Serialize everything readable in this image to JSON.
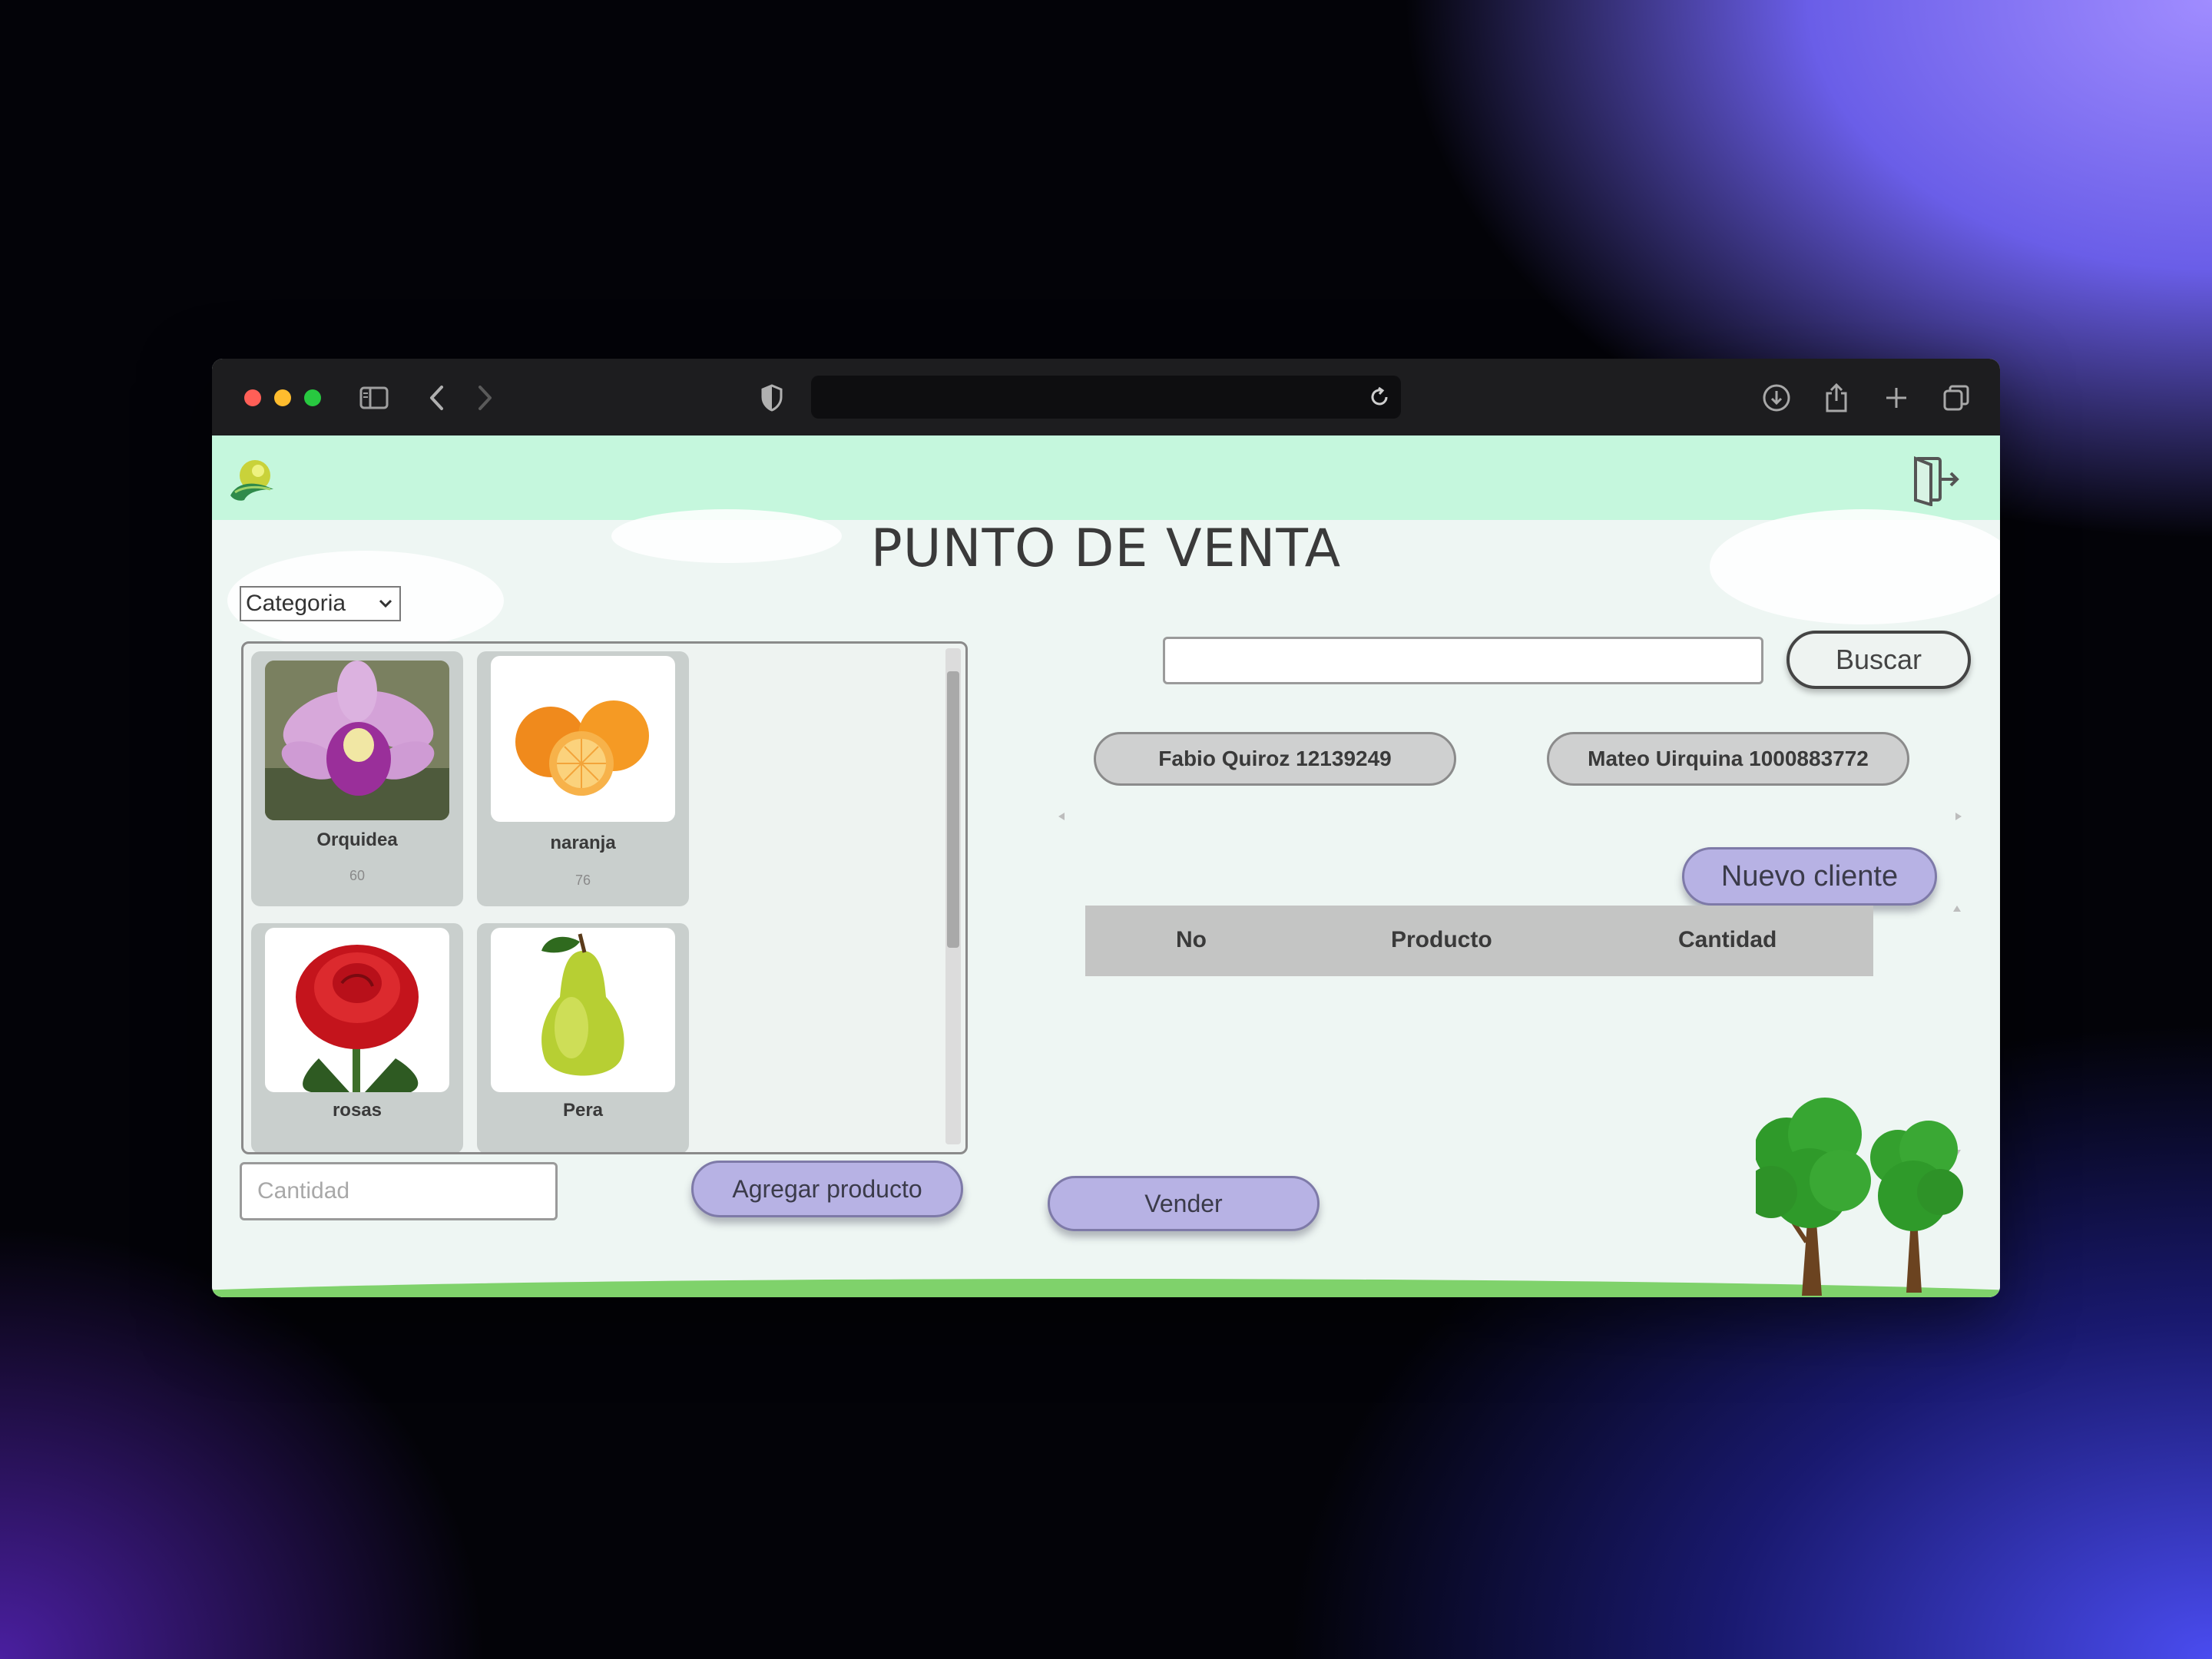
{
  "browser": {
    "url": ""
  },
  "app": {
    "title": "PUNTO DE VENTA",
    "category_select": {
      "value": "Categoria"
    },
    "products": [
      {
        "name": "Orquidea",
        "qty": "60"
      },
      {
        "name": "naranja",
        "qty": "76"
      },
      {
        "name": "rosas",
        "qty": ""
      },
      {
        "name": "Pera",
        "qty": ""
      }
    ],
    "quantity_input": {
      "placeholder": "Cantidad"
    },
    "add_product_label": "Agregar producto",
    "search": {
      "value": "",
      "button_label": "Buscar"
    },
    "clients": [
      "Fabio Quiroz 12139249",
      "Mateo Uirquina 1000883772"
    ],
    "new_client_label": "Nuevo cliente",
    "table": {
      "headers": [
        "No",
        "Producto",
        "Cantidad"
      ],
      "rows": []
    },
    "sell_label": "Vender"
  },
  "icons": {
    "logo": "leaf-logo-icon",
    "logout": "logout-door-icon"
  },
  "colors": {
    "appbar": "#c5f7dd",
    "button_purple": "#b7b2e4",
    "client_pill": "#cfd0d0",
    "ground": "#7fd26b"
  }
}
